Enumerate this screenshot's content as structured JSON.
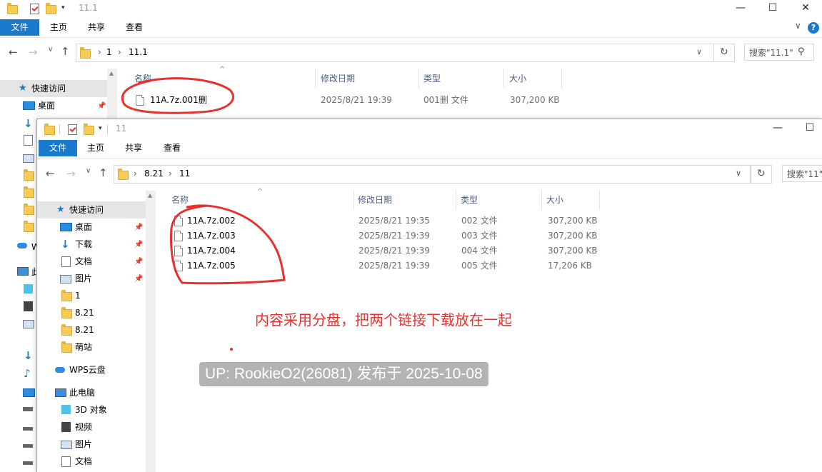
{
  "back_window": {
    "title": "11.1",
    "ribbon": {
      "file": "文件",
      "home": "主页",
      "share": "共享",
      "view": "查看"
    },
    "path": [
      "1",
      "11.1"
    ],
    "search_placeholder": "搜索\"11.1\"",
    "columns": {
      "name": "名称",
      "modified": "修改日期",
      "type": "类型",
      "size": "大小"
    },
    "files": [
      {
        "name": "11A.7z.001删",
        "modified": "2025/8/21 19:39",
        "type": "001删 文件",
        "size": "307,200 KB"
      }
    ],
    "nav": {
      "quick_access": "快速访问",
      "desktop": "桌面",
      "wps_initial": "W",
      "pc_initial": "此"
    }
  },
  "front_window": {
    "title": "11",
    "ribbon": {
      "file": "文件",
      "home": "主页",
      "share": "共享",
      "view": "查看"
    },
    "path": [
      "8.21",
      "11"
    ],
    "search_placeholder": "搜索\"11\"",
    "columns": {
      "name": "名称",
      "modified": "修改日期",
      "type": "类型",
      "size": "大小"
    },
    "files": [
      {
        "name": "11A.7z.002",
        "modified": "2025/8/21 19:35",
        "type": "002 文件",
        "size": "307,200 KB"
      },
      {
        "name": "11A.7z.003",
        "modified": "2025/8/21 19:39",
        "type": "003 文件",
        "size": "307,200 KB"
      },
      {
        "name": "11A.7z.004",
        "modified": "2025/8/21 19:39",
        "type": "004 文件",
        "size": "307,200 KB"
      },
      {
        "name": "11A.7z.005",
        "modified": "2025/8/21 19:39",
        "type": "005 文件",
        "size": "17,206 KB"
      }
    ],
    "nav": {
      "quick_access": "快速访问",
      "items": [
        "桌面",
        "下载",
        "文档",
        "图片",
        "1",
        "8.21",
        "8.21",
        "萌站"
      ],
      "wps": "WPS云盘",
      "this_pc": "此电脑",
      "pc_items": [
        "3D 对象",
        "视频",
        "图片",
        "文档"
      ]
    }
  },
  "annotation": "内容采用分盘，把两个链接下载放在一起",
  "watermark": "UP: RookieO2(26081) 发布于 2025-10-08",
  "colors": {
    "accent": "#1979ca",
    "annotation": "#e8312f",
    "header_text": "#4d6082"
  }
}
